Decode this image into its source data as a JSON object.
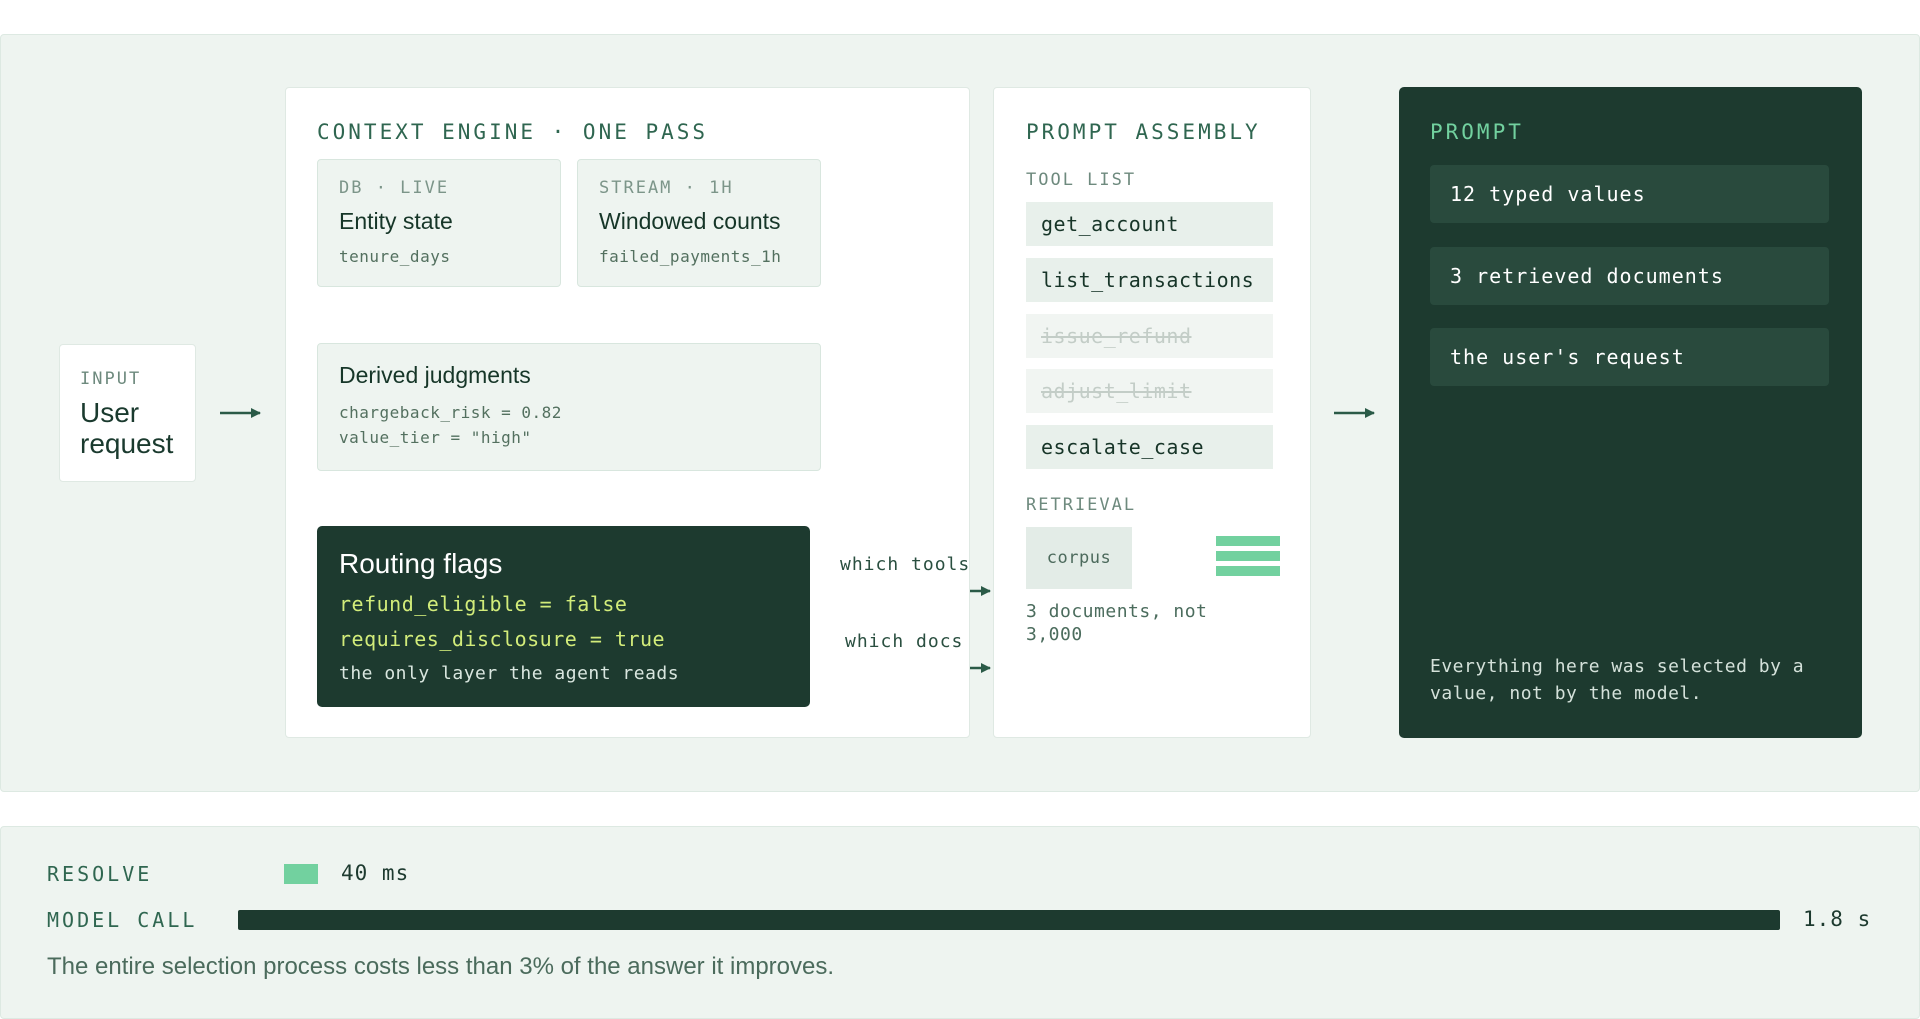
{
  "input": {
    "kicker": "INPUT",
    "title": "User request"
  },
  "engine": {
    "title": "CONTEXT ENGINE · ONE PASS",
    "sources": [
      {
        "kicker": "DB · LIVE",
        "title": "Entity state",
        "field": "tenure_days"
      },
      {
        "kicker": "STREAM · 1H",
        "title": "Windowed counts",
        "field": "failed_payments_1h"
      }
    ],
    "derived": {
      "title": "Derived judgments",
      "lines": [
        "chargeback_risk = 0.82",
        "value_tier = \"high\""
      ]
    },
    "routing": {
      "title": "Routing flags",
      "flags": [
        "refund_eligible = false",
        "requires_disclosure = true"
      ],
      "note": "the only layer the agent reads"
    }
  },
  "edges": {
    "tools_label": "which tools",
    "docs_label": "which docs"
  },
  "assembly": {
    "title": "PROMPT ASSEMBLY",
    "tool_list_label": "TOOL LIST",
    "tools": [
      {
        "name": "get_account",
        "enabled": true
      },
      {
        "name": "list_transactions",
        "enabled": true
      },
      {
        "name": "issue_refund",
        "enabled": false
      },
      {
        "name": "adjust_limit",
        "enabled": false
      },
      {
        "name": "escalate_case",
        "enabled": true
      }
    ],
    "retrieval_label": "RETRIEVAL",
    "corpus_label": "corpus",
    "docs_note": "3 documents, not 3,000"
  },
  "prompt": {
    "title": "PROMPT",
    "items": [
      "12 typed values",
      "3 retrieved documents",
      "the user's request"
    ],
    "note": "Everything here was selected by a value, not by the model."
  },
  "timing": {
    "resolve_label": "RESOLVE",
    "resolve_value": "40 ms",
    "resolve_ms": 40,
    "model_label": "MODEL CALL",
    "model_value": "1.8 s",
    "model_ms": 1800,
    "summary": "The entire selection process costs less than 3% of the answer it improves."
  },
  "colors": {
    "dark": "#1d3a2f",
    "accent_green": "#72d19f",
    "flag_yellow": "#d2ec7a",
    "panel": "#eef4f0"
  }
}
